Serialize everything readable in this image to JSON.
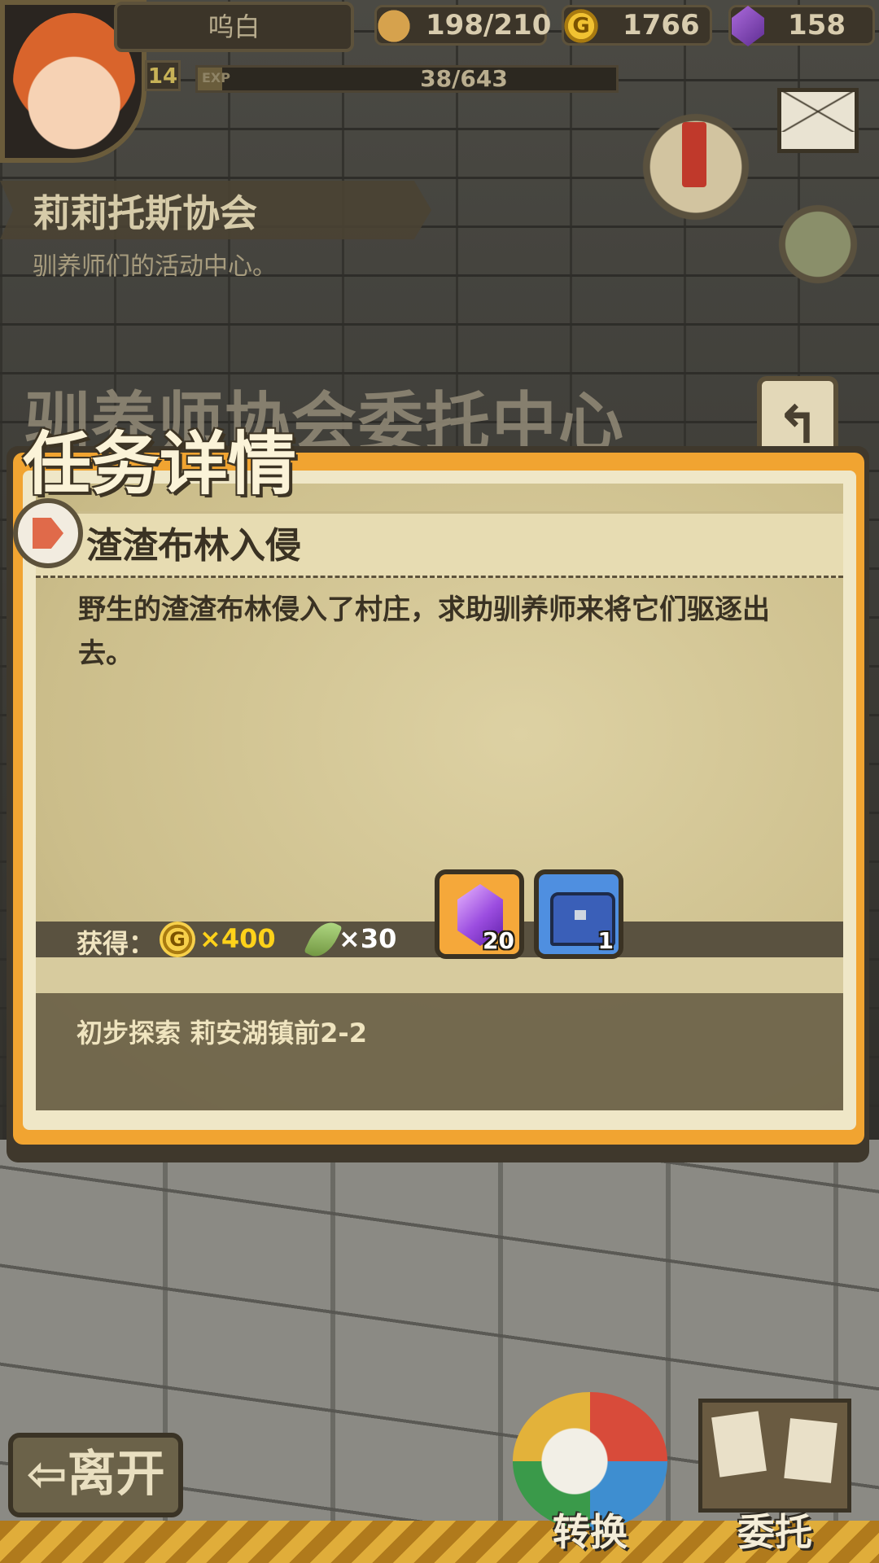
{
  "hud": {
    "player_name": "呜白",
    "level": "14",
    "exp_tag": "EXP",
    "exp_text": "38/643",
    "exp_progress": 0.059,
    "stamina": "198/210",
    "gold": "1766",
    "gems": "158"
  },
  "location": {
    "title": "莉莉托斯协会",
    "subtitle": "驯养师们的活动中心。"
  },
  "board": {
    "title": "驯养师协会委托中心",
    "back_symbol": "↰"
  },
  "panel": {
    "heading": "任务详情",
    "quest_name": "渣渣布林入侵",
    "description": "野生的渣渣布林侵入了村庄，求助驯养师来将它们驱逐出去。",
    "reward_label": "获得：",
    "coin_symbol": "G",
    "coin_reward": "×400",
    "feather_reward": "×30",
    "items": [
      {
        "icon": "purple-gem-icon",
        "qty": "20",
        "color": "#f5a83a"
      },
      {
        "icon": "treasure-chest-icon",
        "qty": "1",
        "color": "#4f8fe0"
      }
    ],
    "location_text": "初步探索  莉安湖镇前2-2"
  },
  "buttons": {
    "leave": "⇦离开",
    "switch": "转换",
    "entrust": "委托"
  },
  "colors": {
    "panel_orange": "#f1a431",
    "gold_text": "#ffd21a",
    "parchment": "#cbbd8a"
  }
}
